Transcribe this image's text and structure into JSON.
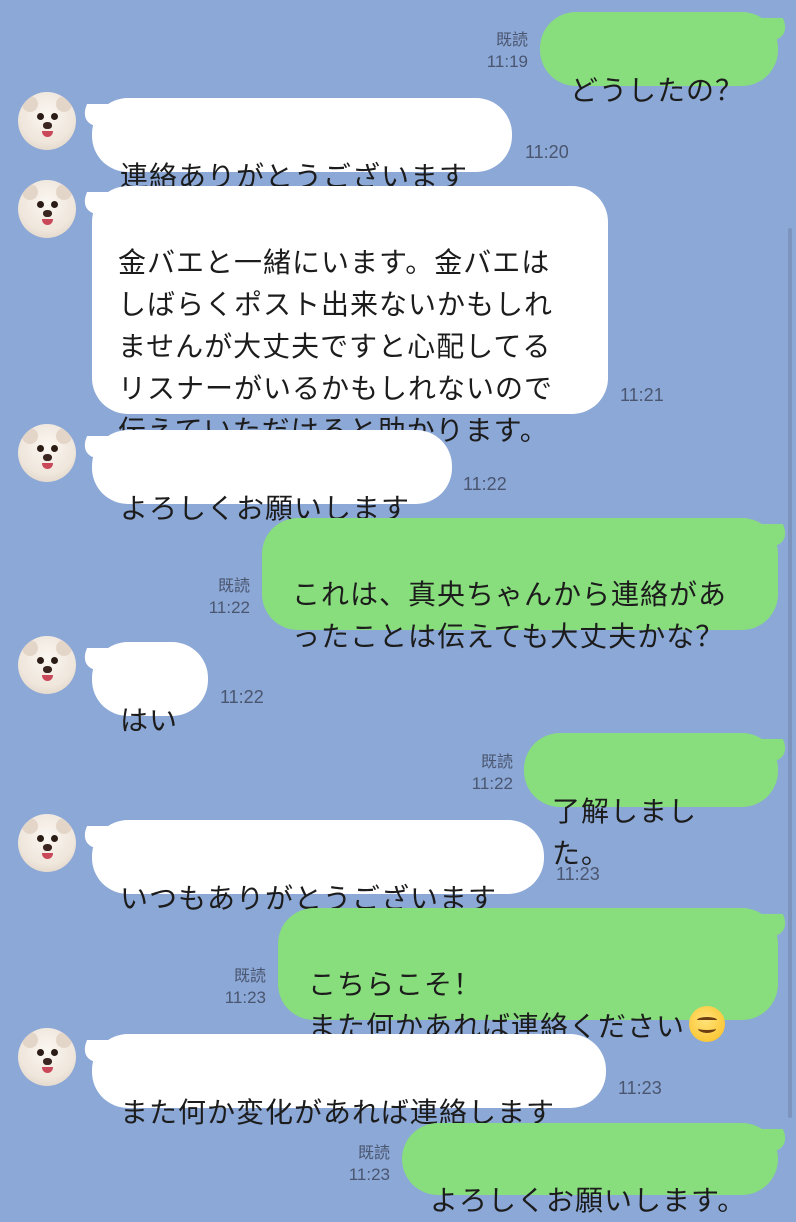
{
  "theme": {
    "background": "#8ca8d6",
    "incoming_bubble": "#ffffff",
    "outgoing_bubble": "#88dd7d"
  },
  "read_label": "既読",
  "messages": [
    {
      "dir": "out",
      "text": "どうしたの？",
      "time": "11:19",
      "read": true
    },
    {
      "dir": "in",
      "text": "連絡ありがとうございます",
      "time": "11:20",
      "avatar": "dog-avatar"
    },
    {
      "dir": "in",
      "text": "金バエと一緒にいます。金バエは\nしばらくポスト出来ないかもしれ\nませんが大丈夫ですと心配してる\nリスナーがいるかもしれないので\n伝えていただけると助かります。",
      "time": "11:21",
      "avatar": "dog-avatar"
    },
    {
      "dir": "in",
      "text": "よろしくお願いします",
      "time": "11:22",
      "avatar": "dog-avatar"
    },
    {
      "dir": "out",
      "text": "これは、真央ちゃんから連絡があ\nったことは伝えても大丈夫かな？",
      "time": "11:22",
      "read": true
    },
    {
      "dir": "in",
      "text": "はい",
      "time": "11:22",
      "avatar": "dog-avatar"
    },
    {
      "dir": "out",
      "text": "了解しました。",
      "time": "11:22",
      "read": true
    },
    {
      "dir": "in",
      "text": "いつもありがとうございます",
      "time": "11:23",
      "avatar": "dog-avatar"
    },
    {
      "dir": "out",
      "text": "こちらこそ！\nまた何かあれば連絡ください",
      "emoji": "smiling-face-emoji",
      "time": "11:23",
      "read": true
    },
    {
      "dir": "in",
      "text": "また何か変化があれば連絡します",
      "time": "11:23",
      "avatar": "dog-avatar"
    },
    {
      "dir": "out",
      "text": "よろしくお願いします。",
      "time": "11:23",
      "read": true
    }
  ]
}
